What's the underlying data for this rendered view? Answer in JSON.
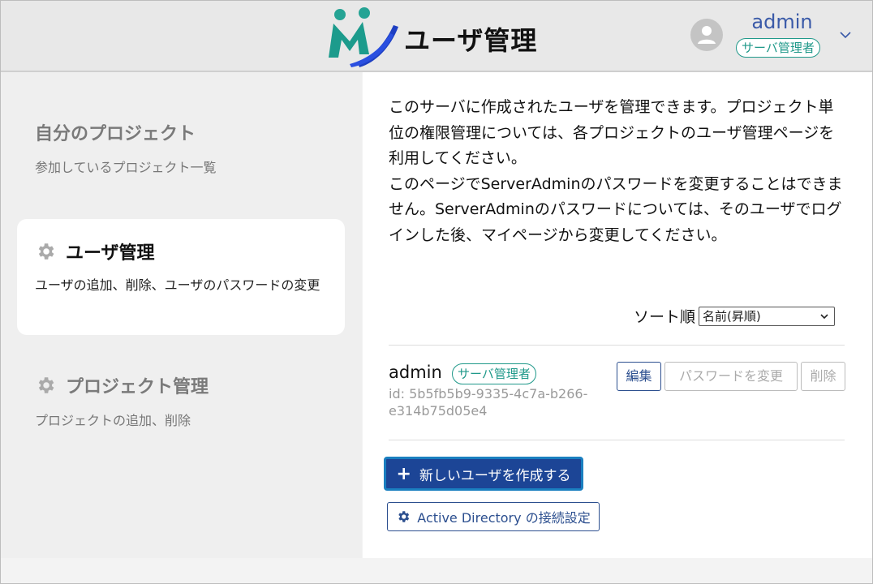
{
  "header": {
    "app_title": "ユーザ管理",
    "username": "admin",
    "role_badge": "サーバ管理者"
  },
  "sidebar": {
    "items": [
      {
        "title": "自分のプロジェクト",
        "subtitle": "参加しているプロジェクト一覧"
      },
      {
        "title": "ユーザ管理",
        "subtitle": "ユーザの追加、削除、ユーザのパスワードの変更"
      },
      {
        "title": "プロジェクト管理",
        "subtitle": "プロジェクトの追加、削除"
      }
    ]
  },
  "main": {
    "description": "このサーバに作成されたユーザを管理できます。プロジェクト単位の権限管理については、各プロジェクトのユーザ管理ページを利用してください。\nこのページでServerAdminのパスワードを変更することはできません。ServerAdminのパスワードについては、そのユーザでログインした後、マイページから変更してください。",
    "sort_label": "ソート順",
    "sort_value": "名前(昇順)",
    "users": [
      {
        "name": "admin",
        "role": "サーバ管理者",
        "id": "id: 5b5fb5b9-9335-4c7a-b266-e314b75d05e4",
        "edit_label": "編集",
        "password_label": "パスワードを変更",
        "delete_label": "削除"
      }
    ],
    "create_button": "新しいユーザを作成する",
    "create_icon": "+",
    "ad_button": "Active Directory の接続設定"
  },
  "colors": {
    "accent": "#1c4596",
    "teal": "#20998a",
    "link": "#3a5aa8"
  }
}
